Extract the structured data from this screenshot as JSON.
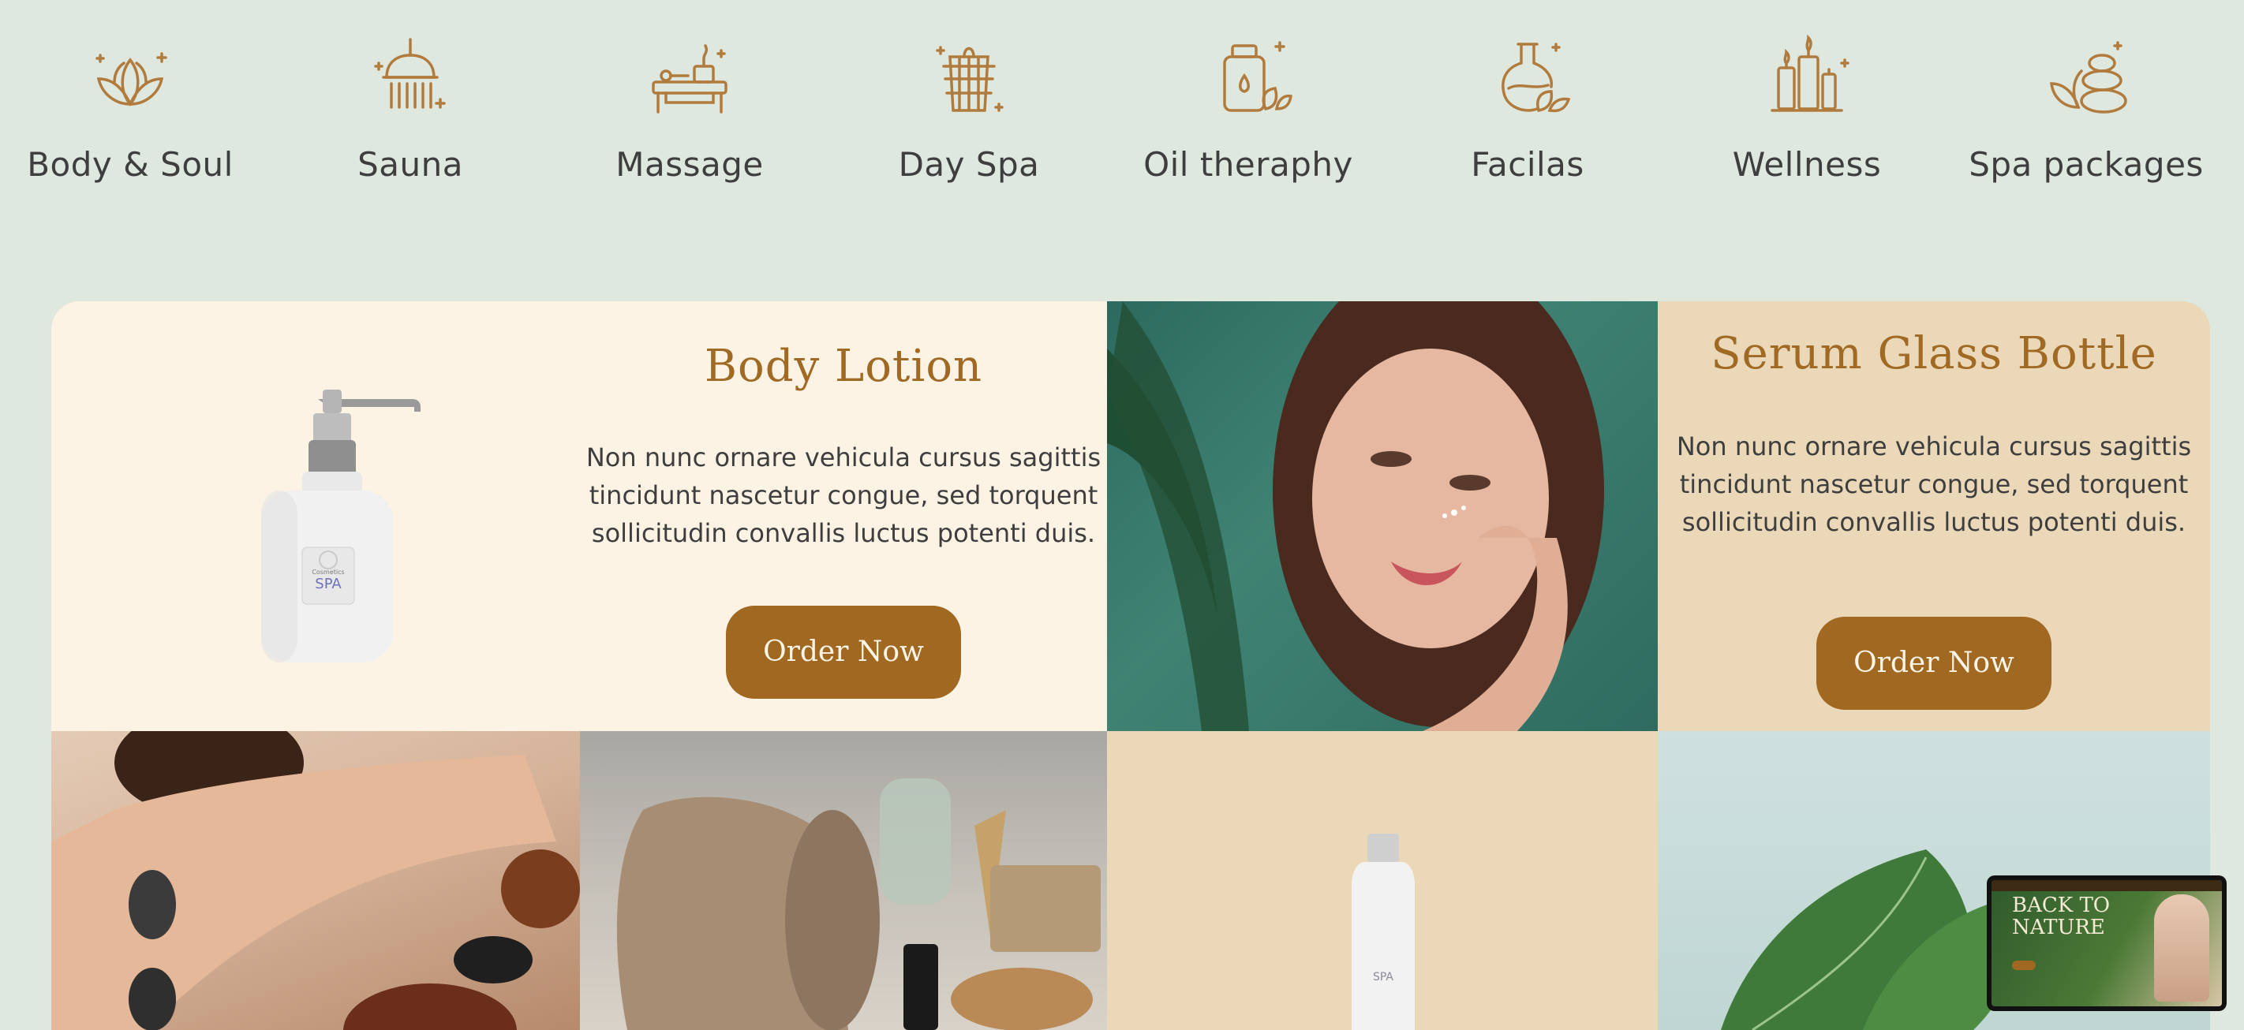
{
  "categories": [
    {
      "label": "Body & Soul",
      "icon": "lotus-icon"
    },
    {
      "label": "Sauna",
      "icon": "shower-icon"
    },
    {
      "label": "Massage",
      "icon": "massage-table-icon"
    },
    {
      "label": "Day Spa",
      "icon": "bucket-icon"
    },
    {
      "label": "Oil theraphy",
      "icon": "oil-jar-icon"
    },
    {
      "label": "Facilas",
      "icon": "flask-leaf-icon"
    },
    {
      "label": "Wellness",
      "icon": "candles-icon"
    },
    {
      "label": "Spa packages",
      "icon": "stones-lotus-icon"
    }
  ],
  "products": [
    {
      "title": "Body Lotion",
      "description_lines": [
        "Non nunc ornare vehicula cursus sagittis",
        "tincidunt nascetur congue, sed torquent",
        "sollicitudin  convallis luctus potenti duis."
      ],
      "button": "Order Now",
      "bottle_label_top": "Cosmetics",
      "bottle_label": "SPA"
    },
    {
      "title": "Serum Glass Bottle",
      "description_lines": [
        "Non nunc ornare vehicula cursus sagittis",
        "tincidunt nascetur congue, sed torquent",
        "sollicitudin  convallis luctus potenti duis."
      ],
      "button": "Order Now"
    }
  ],
  "bottom_bottle_label": "SPA",
  "mini_preview": {
    "title": "BACK TO NATURE"
  },
  "colors": {
    "accent": "#a06820",
    "title": "#a06a24",
    "background": "#dfe8df",
    "cream": "#fcf3e4",
    "tan": "#ead8b8"
  }
}
